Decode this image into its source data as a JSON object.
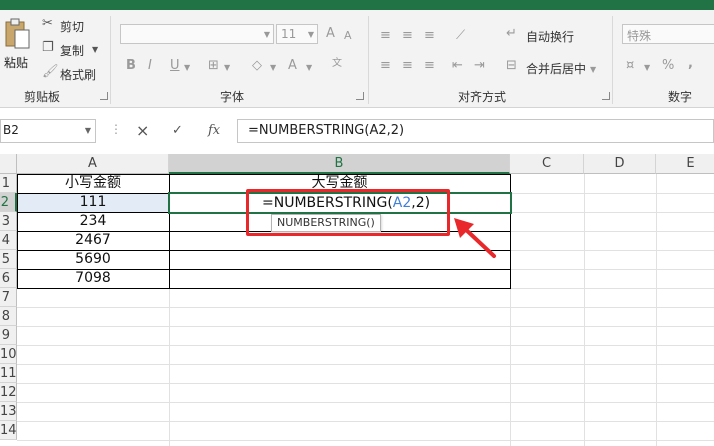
{
  "ribbon": {
    "clipboard": {
      "paste_label": "粘贴",
      "cut_label": "剪切",
      "copy_label": "复制",
      "format_painter_label": "格式刷",
      "group_label": "剪贴板"
    },
    "font": {
      "font_size": "11",
      "group_label": "字体",
      "bold": "B",
      "italic": "I",
      "underline": "U"
    },
    "alignment": {
      "wrap_text_label": "自动换行",
      "merge_center_label": "合并后居中",
      "group_label": "对齐方式"
    },
    "number": {
      "format_value": "特殊",
      "percent": "%",
      "comma": ",",
      "group_label": "数字"
    }
  },
  "formula_bar": {
    "name_box": "B2",
    "cancel_icon": "×",
    "confirm_icon": "✓",
    "fx_label": "fx",
    "formula": "=NUMBERSTRING(A2,2)"
  },
  "columns": [
    "A",
    "B",
    "C",
    "D",
    "E"
  ],
  "rows": [
    "1",
    "2",
    "3",
    "4",
    "5",
    "6",
    "7",
    "8",
    "9",
    "10",
    "11",
    "12",
    "13",
    "14"
  ],
  "cells": {
    "A1": "小写金额",
    "B1": "大写金额",
    "A2": "111",
    "A3": "234",
    "A4": "2467",
    "A5": "5690",
    "A6": "7098"
  },
  "editing": {
    "prefix": "=NUMBERSTRING(",
    "ref": "A2",
    "suffix": ",2)",
    "tooltip": "NUMBERSTRING()"
  },
  "colors": {
    "excel_green": "#217346",
    "annotation_red": "#e8282a",
    "reference_blue": "#3f7fd6"
  }
}
